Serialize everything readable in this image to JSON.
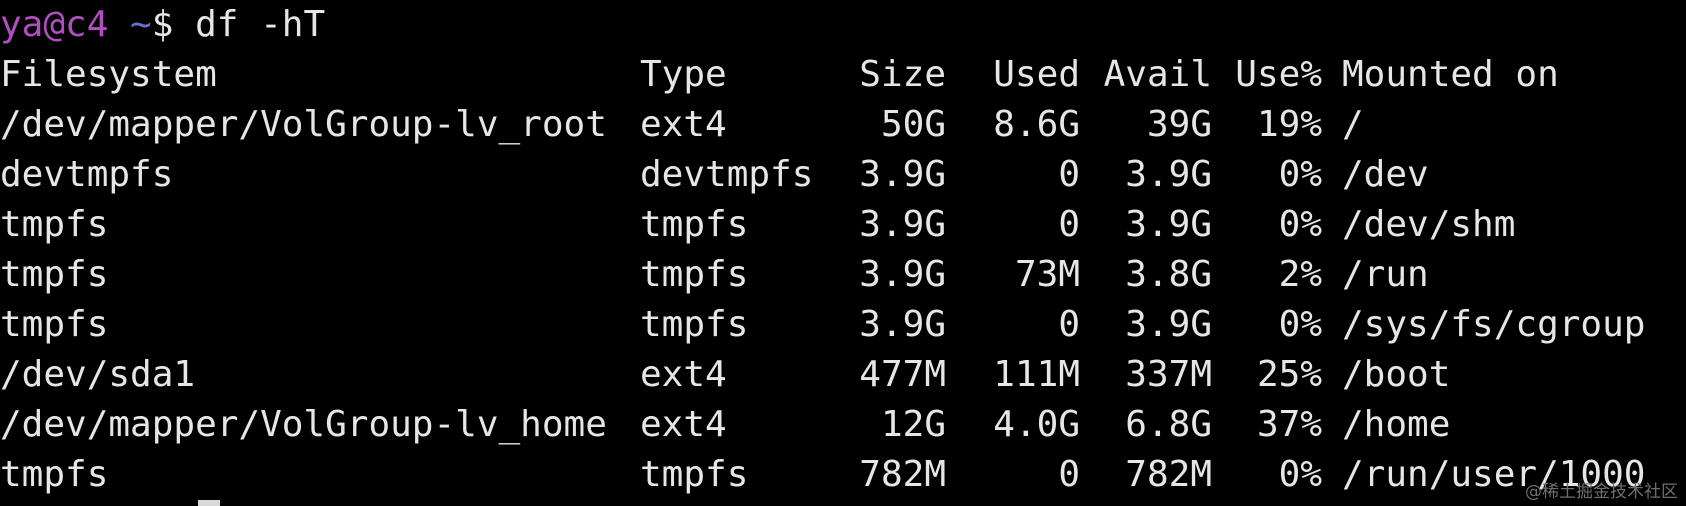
{
  "prompt": {
    "user_host": "ya@c4",
    "path": " ~",
    "symbol": "$ ",
    "command": "df -hT"
  },
  "table": {
    "headers": {
      "filesystem": "Filesystem",
      "type": "Type",
      "size": "Size",
      "used": "Used",
      "avail": "Avail",
      "use_pct": "Use%",
      "mounted": "Mounted on"
    },
    "rows": [
      {
        "filesystem": "/dev/mapper/VolGroup-lv_root",
        "type": "ext4",
        "size": "50G",
        "used": "8.6G",
        "avail": "39G",
        "use_pct": "19%",
        "mounted": "/"
      },
      {
        "filesystem": "devtmpfs",
        "type": "devtmpfs",
        "size": "3.9G",
        "used": "0",
        "avail": "3.9G",
        "use_pct": "0%",
        "mounted": "/dev"
      },
      {
        "filesystem": "tmpfs",
        "type": "tmpfs",
        "size": "3.9G",
        "used": "0",
        "avail": "3.9G",
        "use_pct": "0%",
        "mounted": "/dev/shm"
      },
      {
        "filesystem": "tmpfs",
        "type": "tmpfs",
        "size": "3.9G",
        "used": "73M",
        "avail": "3.8G",
        "use_pct": "2%",
        "mounted": "/run"
      },
      {
        "filesystem": "tmpfs",
        "type": "tmpfs",
        "size": "3.9G",
        "used": "0",
        "avail": "3.9G",
        "use_pct": "0%",
        "mounted": "/sys/fs/cgroup"
      },
      {
        "filesystem": "/dev/sda1",
        "type": "ext4",
        "size": "477M",
        "used": "111M",
        "avail": "337M",
        "use_pct": "25%",
        "mounted": "/boot"
      },
      {
        "filesystem": "/dev/mapper/VolGroup-lv_home",
        "type": "ext4",
        "size": "12G",
        "used": "4.0G",
        "avail": "6.8G",
        "use_pct": "37%",
        "mounted": "/home"
      },
      {
        "filesystem": "tmpfs",
        "type": "tmpfs",
        "size": "782M",
        "used": "0",
        "avail": "782M",
        "use_pct": "0%",
        "mounted": "/run/user/1000"
      }
    ]
  },
  "watermark": "@稀土掘金技术社区",
  "colors": {
    "background": "#000000",
    "text": "#e6e6e6",
    "prompt_user": "#b04fc0",
    "prompt_path": "#6a6fd6"
  }
}
